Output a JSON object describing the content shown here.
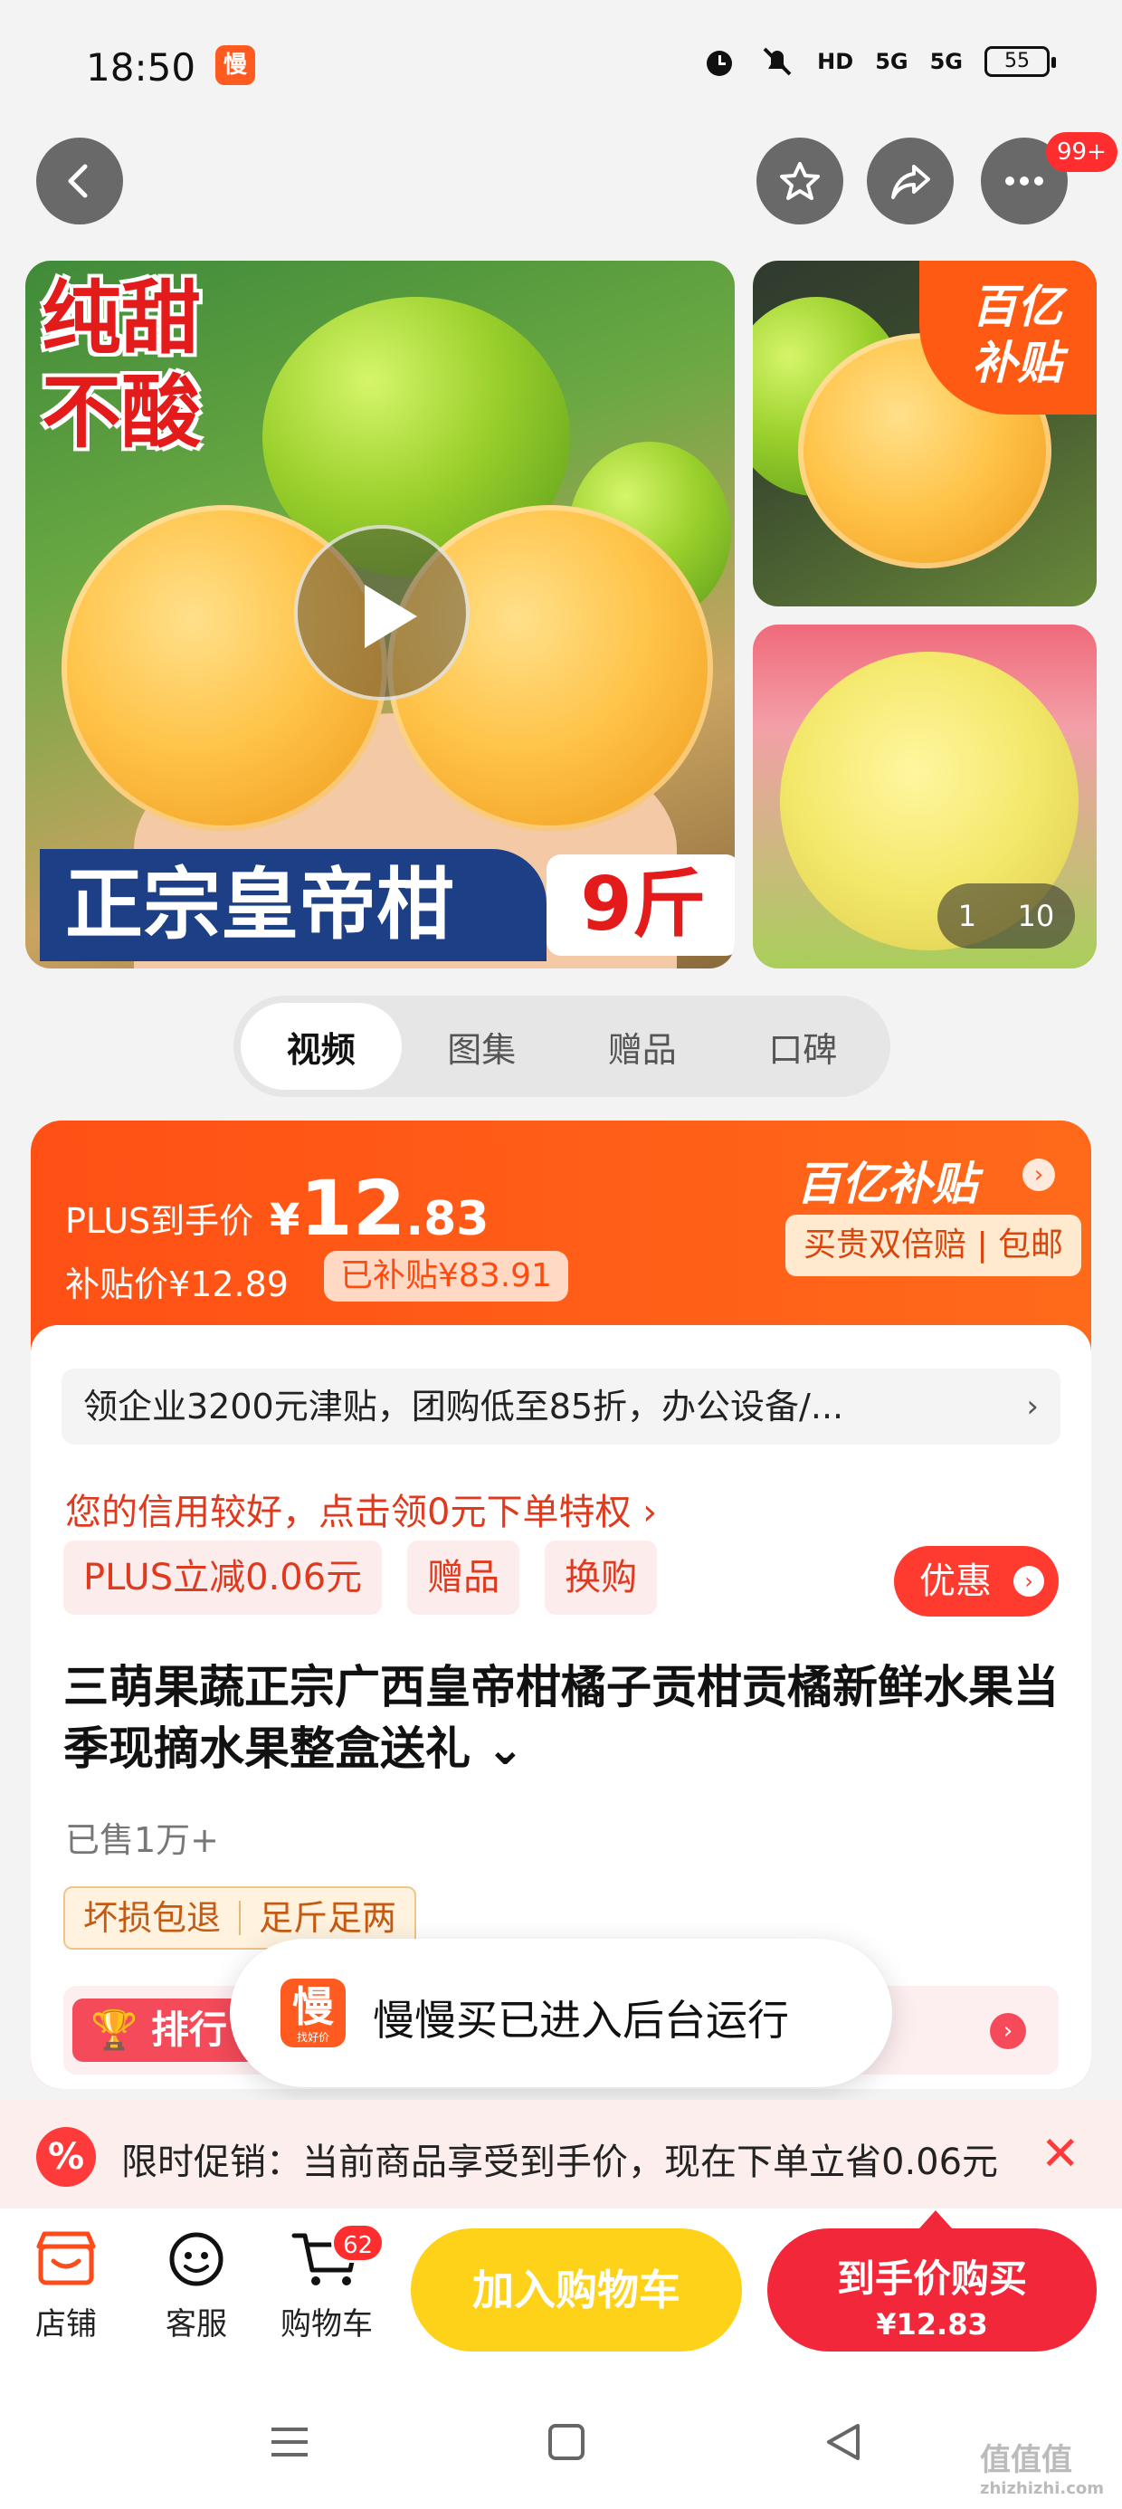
{
  "status_bar": {
    "time": "18:50",
    "app_icon_char": "慢",
    "hd_label": "HD",
    "signal_1": "5G",
    "signal_2": "5G",
    "battery": "55"
  },
  "top_nav": {
    "more_badge": "99+"
  },
  "gallery": {
    "banner_top": "纯甜\n不酸",
    "banner_bottom_main": "正宗皇帝柑",
    "banner_bottom_weight": "9斤",
    "side_badge": "百亿\n补贴",
    "counter_current": "1",
    "counter_total": "10"
  },
  "media_tabs": [
    {
      "label": "视频",
      "active": true
    },
    {
      "label": "图集",
      "active": false
    },
    {
      "label": "赠品",
      "active": false
    },
    {
      "label": "口碑",
      "active": false
    }
  ],
  "price": {
    "plus_label": "PLUS到手价",
    "currency": "¥",
    "price_int": "12",
    "price_dec": ".83",
    "subsidy_label": "补贴价¥12.89",
    "subsidy_amount": "已补贴¥83.91",
    "yiyi_title": "百亿补贴",
    "yiyi_tags": "买贵双倍赔 | 包邮"
  },
  "info": {
    "enterprise": "领企业3200元津贴，团购低至85折，办公设备/...",
    "credit": "您的信用较好，点击领0元下单特权 ›",
    "tags": [
      "PLUS立减0.06元",
      "赠品",
      "换购"
    ],
    "youhui": "优惠",
    "title": "三萌果蔬正宗广西皇帝柑橘子贡柑贡橘新鲜水果当季现摘水果整盒送礼 ⌄",
    "sold": "已售1万+",
    "guarantee_1": "坏损包退",
    "guarantee_2": "足斤足两",
    "rank_label": "排行"
  },
  "toast": {
    "icon_char": "慢",
    "icon_sub": "找好价",
    "text": "慢慢买已进入后台运行"
  },
  "promo": {
    "icon": "%",
    "text": "限时促销：当前商品享受到手价，现在下单立省0.06元",
    "close": "✕"
  },
  "action_bar": {
    "shop": "店铺",
    "service": "客服",
    "cart": "购物车",
    "cart_count": "62",
    "add_to_cart": "加入购物车",
    "buy_line1": "到手价购买",
    "buy_line2": "¥12.83"
  },
  "watermark": {
    "main": "值值值",
    "sub": "zhizhizhi.com"
  },
  "colors": {
    "accent_orange": "#ff5a14",
    "buy_red": "#f2283a",
    "cart_yellow": "#ffd21a"
  }
}
